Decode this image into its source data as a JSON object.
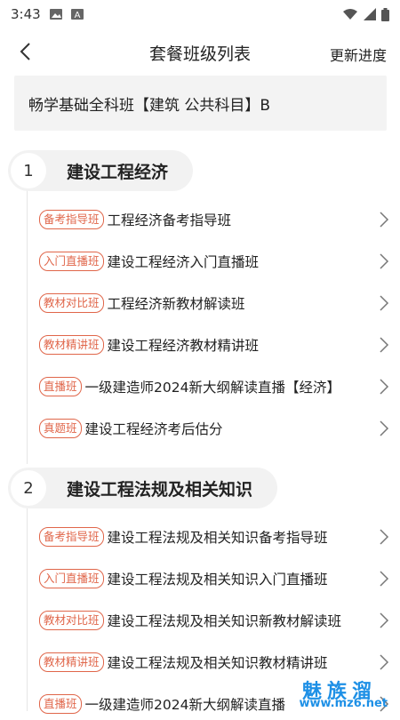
{
  "status_bar": {
    "time": "3:43",
    "icons": [
      "image-icon",
      "a-icon",
      "wifi-icon",
      "signal-icon",
      "battery-icon"
    ]
  },
  "navbar": {
    "back_icon": "chevron-left-icon",
    "title": "套餐班级列表",
    "action": "更新进度"
  },
  "course_name": "畅学基础全科班【建筑 公共科目】B",
  "sections": [
    {
      "number": "1",
      "title": "建设工程经济",
      "items": [
        {
          "tag": "备考指导班",
          "title": "工程经济备考指导班"
        },
        {
          "tag": "入门直播班",
          "title": "建设工程经济入门直播班"
        },
        {
          "tag": "教材对比班",
          "title": "工程经济新教材解读班"
        },
        {
          "tag": "教材精讲班",
          "title": "建设工程经济教材精讲班"
        },
        {
          "tag": "直播班",
          "title": "一级建造师2024新大纲解读直播【经济】"
        },
        {
          "tag": "真题班",
          "title": "建设工程经济考后估分"
        }
      ]
    },
    {
      "number": "2",
      "title": "建设工程法规及相关知识",
      "items": [
        {
          "tag": "备考指导班",
          "title": "建设工程法规及相关知识备考指导班"
        },
        {
          "tag": "入门直播班",
          "title": "建设工程法规及相关知识入门直播班"
        },
        {
          "tag": "教材对比班",
          "title": "建设工程法规及相关知识新教材解读班"
        },
        {
          "tag": "教材精讲班",
          "title": "建设工程法规及相关知识教材精讲班"
        },
        {
          "tag": "直播班",
          "title": "一级建造师2024新大纲解读直播"
        }
      ]
    }
  ],
  "watermark": {
    "line1": "魅族溜",
    "line2": "www.mz6.net"
  },
  "colors": {
    "tag": "#e0664a",
    "watermark": "#1e90e6",
    "course_box_bg": "#f3f3f3"
  }
}
